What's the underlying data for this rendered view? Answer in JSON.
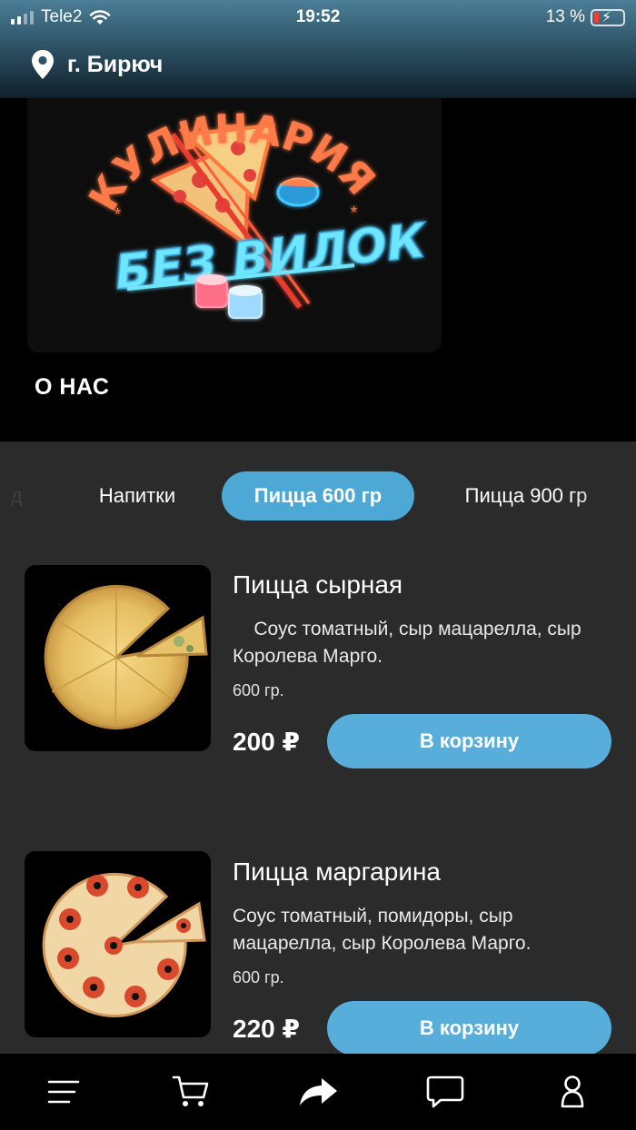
{
  "status_bar": {
    "carrier": "Tele2",
    "time": "19:52",
    "battery": "13 %"
  },
  "header": {
    "city": "г. Бирюч",
    "location_icon": "location-pin-icon"
  },
  "hero": {
    "logo_top_text": "КУЛИНАРИЯ",
    "logo_bottom_text": "БЕЗ ВИЛОК",
    "about_label": "О НАС"
  },
  "category_tabs": {
    "items": [
      {
        "label": "д"
      },
      {
        "label": "Напитки"
      },
      {
        "label": "Пицца 600 гр"
      },
      {
        "label": "Пицца 900 гр"
      }
    ],
    "active_index": 2
  },
  "products": [
    {
      "name": "Пицца сырная",
      "description": "    Соус томатный, сыр мацарелла, сыр Королева Марго.",
      "weight": "600 гр.",
      "price": "200 ₽",
      "button": "В корзину"
    },
    {
      "name": "Пицца маргарина",
      "description": "Соус томатный, помидоры, сыр мацарелла, сыр Королева Марго.",
      "weight": "600 гр.",
      "price": "220 ₽",
      "button": "В корзину"
    }
  ],
  "bottom_nav": {
    "items": [
      {
        "icon": "menu-icon"
      },
      {
        "icon": "cart-icon"
      },
      {
        "icon": "share-icon"
      },
      {
        "icon": "chat-icon"
      },
      {
        "icon": "profile-icon"
      }
    ]
  },
  "colors": {
    "accent": "#4ea8d6",
    "background": "#2b2b2b",
    "hero_bg": "#000000"
  }
}
